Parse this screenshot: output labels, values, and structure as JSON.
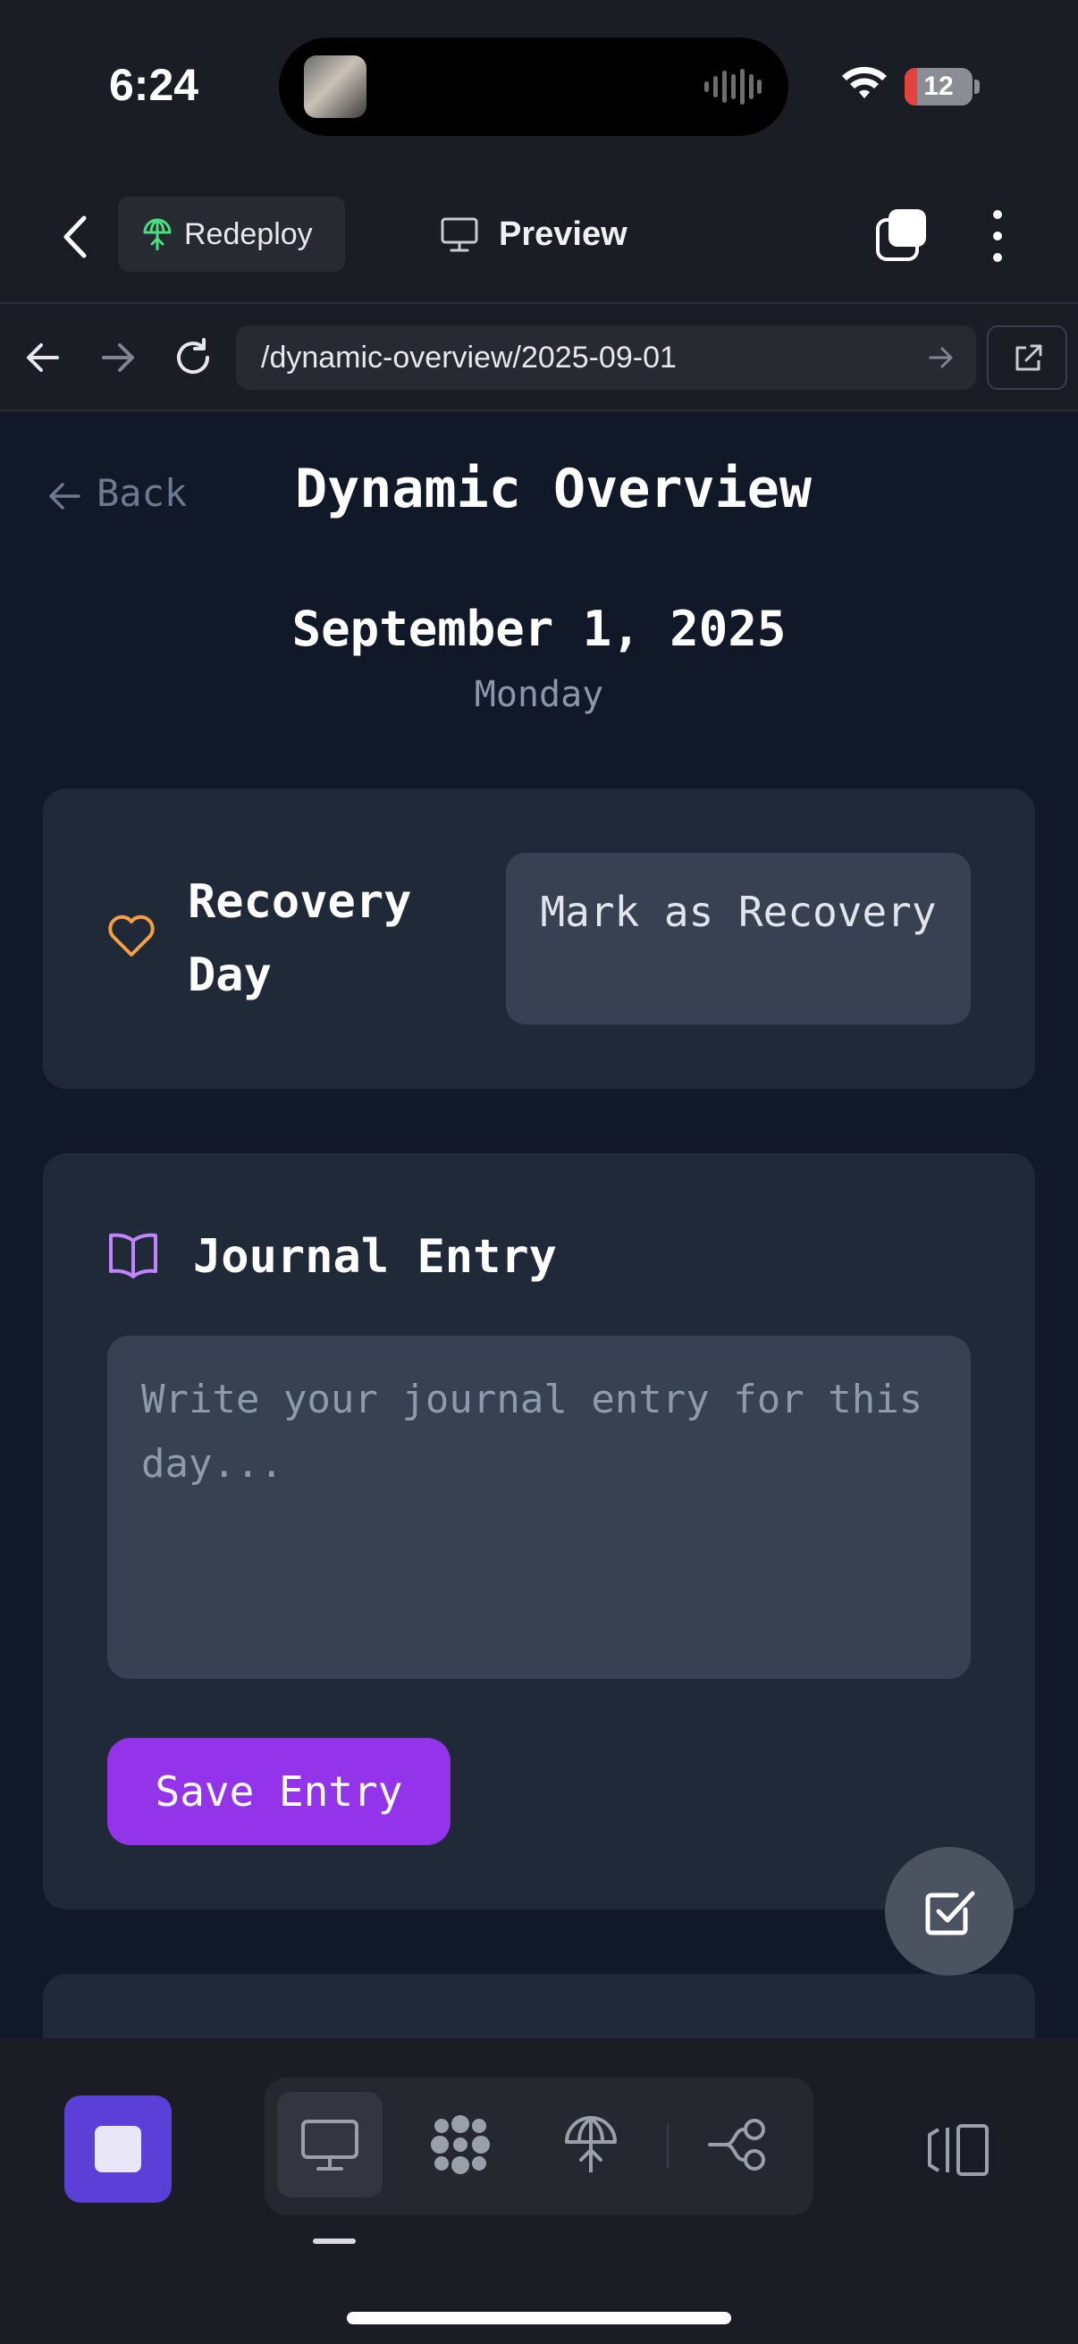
{
  "status_bar": {
    "time": "6:24",
    "battery": "12"
  },
  "header": {
    "redeploy_label": "Redeploy",
    "preview_label": "Preview"
  },
  "url_bar": {
    "url": "/dynamic-overview/2025-09-01"
  },
  "page": {
    "back_label": "Back",
    "title": "Dynamic Overview",
    "date": "September 1, 2025",
    "weekday": "Monday"
  },
  "recovery_card": {
    "title": "Recovery Day",
    "button_label": "Mark as Recovery",
    "heart_color": "#f59e42"
  },
  "journal_card": {
    "title": "Journal Entry",
    "placeholder": "Write your journal entry for this day...",
    "value": "",
    "save_label": "Save Entry",
    "icon_color": "#c084fc",
    "button_color": "#9333ea"
  },
  "toolbar": {
    "items": [
      {
        "icon": "monitor-icon",
        "active": true
      },
      {
        "icon": "grid-dots-icon",
        "active": false
      },
      {
        "icon": "deploy-umbrella-icon",
        "active": false
      },
      {
        "icon": "flow-branch-icon",
        "active": false
      }
    ],
    "accent": "#5b3fd6"
  }
}
